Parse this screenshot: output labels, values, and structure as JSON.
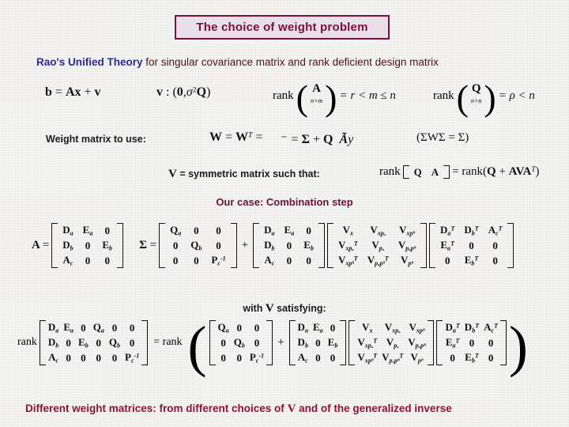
{
  "slide": {
    "title": "The choice of weight problem",
    "theory_label": "Rao's Unified Theory",
    "theory_rest": " for singular covariance matrix and rank deficient design matrix",
    "weight_matrix_label": "Weight matrix to use:",
    "v_definition_label": "V = symmetric matrix such that:",
    "our_case_label": "Our case: Combination step",
    "with_v_label": "with V satisfying:",
    "caption_pre": "Different weight matrices: from different choices of ",
    "caption_v": "V",
    "caption_post": " and of the generalized inverse"
  },
  "formulas": {
    "model": "b = Ax + v",
    "noise": "v : (0, σ²Q)",
    "rank_a": "rank(A n×m) = r < m ≤ n",
    "rank_a_inner": "A",
    "rank_a_sub": "n×m",
    "rank_a_rhs": "= r < m ≤ n",
    "rank_q_inner": "Q",
    "rank_q_sub": "n×n",
    "rank_q_rhs": "= ρ < n",
    "w_chain": "W = W",
    "w_chain_sup": "T",
    "w_broken": "− = Σ ⁻ + Q Ãу",
    "sigma_identity": "(ΣWΣ = Σ)",
    "rank_qa": "rank",
    "rank_qa_rhs": "= rank(Q + AVA",
    "rank_qa_sup": "T",
    "rank_qa_close": ")"
  },
  "labels": {
    "A_eq": "A =",
    "Sigma_eq": "Σ =",
    "plus": "+",
    "rank_word": "rank",
    "equals": "=",
    "eq_rank": "= rank"
  },
  "matrices": {
    "A": {
      "name": "A",
      "rows": [
        [
          {
            "b": "D",
            "sub": "a"
          },
          {
            "b": "E",
            "sub": "a"
          },
          {
            "b": "0"
          }
        ],
        [
          {
            "b": "D",
            "sub": "b"
          },
          {
            "b": "0"
          },
          {
            "b": "E",
            "sub": "b"
          }
        ],
        [
          {
            "b": "A",
            "sub": "c"
          },
          {
            "b": "0"
          },
          {
            "b": "0"
          }
        ]
      ]
    },
    "Sigma": {
      "name": "Σ",
      "rows": [
        [
          {
            "b": "Q",
            "sub": "a"
          },
          {
            "b": "0"
          },
          {
            "b": "0"
          }
        ],
        [
          {
            "b": "0"
          },
          {
            "b": "Q",
            "sub": "b"
          },
          {
            "b": "0"
          }
        ],
        [
          {
            "b": "0"
          },
          {
            "b": "0"
          },
          {
            "b": "P",
            "sub": "c",
            "sup": "-1"
          }
        ]
      ]
    },
    "A2": {
      "rows": [
        [
          {
            "b": "D",
            "sub": "a"
          },
          {
            "b": "E",
            "sub": "a"
          },
          {
            "b": "0"
          }
        ],
        [
          {
            "b": "D",
            "sub": "b"
          },
          {
            "b": "0"
          },
          {
            "b": "E",
            "sub": "b"
          }
        ],
        [
          {
            "b": "A",
            "sub": "c"
          },
          {
            "b": "0"
          },
          {
            "b": "0"
          }
        ]
      ]
    },
    "V": {
      "name": "V",
      "rows": [
        [
          {
            "b": "V",
            "sub": "x"
          },
          {
            "b": "V",
            "sub": "xpₐ"
          },
          {
            "b": "V",
            "sub": "xpᵇ"
          }
        ],
        [
          {
            "b": "V",
            "sub": "xpₐ",
            "sup": "T"
          },
          {
            "b": "V",
            "sub": "pₐ"
          },
          {
            "b": "V",
            "sub": "pₐpᵇ"
          }
        ],
        [
          {
            "b": "V",
            "sub": "xpᵇ",
            "sup": "T"
          },
          {
            "b": "V",
            "sub": "pₐpᵇ",
            "sup": "T"
          },
          {
            "b": "V",
            "sub": "pᵇ"
          }
        ]
      ]
    },
    "AT": {
      "rows": [
        [
          {
            "b": "D",
            "sub": "a",
            "sup": "T"
          },
          {
            "b": "D",
            "sub": "b",
            "sup": "T"
          },
          {
            "b": "A",
            "sub": "c",
            "sup": "T"
          }
        ],
        [
          {
            "b": "E",
            "sub": "a",
            "sup": "T"
          },
          {
            "b": "0"
          },
          {
            "b": "0"
          }
        ],
        [
          {
            "b": "0"
          },
          {
            "b": "E",
            "sub": "b",
            "sup": "T"
          },
          {
            "b": "0"
          }
        ]
      ]
    },
    "big_left": {
      "rows": [
        [
          {
            "b": "D",
            "sub": "a"
          },
          {
            "b": "E",
            "sub": "a"
          },
          {
            "b": "0"
          },
          {
            "b": "Q",
            "sub": "a"
          },
          {
            "b": "0"
          },
          {
            "b": "0"
          }
        ],
        [
          {
            "b": "D",
            "sub": "b"
          },
          {
            "b": "0"
          },
          {
            "b": "E",
            "sub": "b"
          },
          {
            "b": "0"
          },
          {
            "b": "Q",
            "sub": "b"
          },
          {
            "b": "0"
          }
        ],
        [
          {
            "b": "A",
            "sub": "c"
          },
          {
            "b": "0"
          },
          {
            "b": "0"
          },
          {
            "b": "0"
          },
          {
            "b": "0"
          },
          {
            "b": "P",
            "sub": "c",
            "sup": "-1"
          }
        ]
      ]
    },
    "big_sigma": {
      "rows": [
        [
          {
            "b": "Q",
            "sub": "a"
          },
          {
            "b": "0"
          },
          {
            "b": "0"
          }
        ],
        [
          {
            "b": "0"
          },
          {
            "b": "Q",
            "sub": "b"
          },
          {
            "b": "0"
          }
        ],
        [
          {
            "b": "0"
          },
          {
            "b": "0"
          },
          {
            "b": "P",
            "sub": "c",
            "sup": "-1"
          }
        ]
      ]
    },
    "big_A": {
      "rows": [
        [
          {
            "b": "D",
            "sub": "a"
          },
          {
            "b": "E",
            "sub": "a"
          },
          {
            "b": "0"
          }
        ],
        [
          {
            "b": "D",
            "sub": "b"
          },
          {
            "b": "0"
          },
          {
            "b": "E",
            "sub": "b"
          }
        ],
        [
          {
            "b": "A",
            "sub": "c"
          },
          {
            "b": "0"
          },
          {
            "b": "0"
          }
        ]
      ]
    },
    "big_V": {
      "rows": [
        [
          {
            "b": "V",
            "sub": "x"
          },
          {
            "b": "V",
            "sub": "xpₐ"
          },
          {
            "b": "V",
            "sub": "xpᵇ"
          }
        ],
        [
          {
            "b": "V",
            "sub": "xpₐ",
            "sup": "T"
          },
          {
            "b": "V",
            "sub": "pₐ"
          },
          {
            "b": "V",
            "sub": "pₐpᵇ"
          }
        ],
        [
          {
            "b": "V",
            "sub": "xpᵇ",
            "sup": "T"
          },
          {
            "b": "V",
            "sub": "pₐpᵇ",
            "sup": "T"
          },
          {
            "b": "V",
            "sub": "pᵇ"
          }
        ]
      ]
    },
    "big_AT": {
      "rows": [
        [
          {
            "b": "D",
            "sub": "a",
            "sup": "T"
          },
          {
            "b": "D",
            "sub": "b",
            "sup": "T"
          },
          {
            "b": "A",
            "sub": "c",
            "sup": "T"
          }
        ],
        [
          {
            "b": "E",
            "sub": "a",
            "sup": "T"
          },
          {
            "b": "0"
          },
          {
            "b": "0"
          }
        ],
        [
          {
            "b": "0"
          },
          {
            "b": "E",
            "sub": "b",
            "sup": "T"
          },
          {
            "b": "0"
          }
        ]
      ]
    },
    "QA_inline": {
      "rows": [
        [
          {
            "b": "Q"
          },
          {
            "b": "A"
          }
        ]
      ]
    }
  },
  "colors": {
    "title_text": "#7a1040",
    "title_fill": "#e8dfe8",
    "title_border": "#7a1040",
    "theory_blue": "#2b2b8f",
    "body_maroon": "#4a1020",
    "heading_maroon": "#6d1038",
    "caption_maroon": "#8c1338",
    "background": "#efeeea",
    "math_black": "#111111"
  }
}
